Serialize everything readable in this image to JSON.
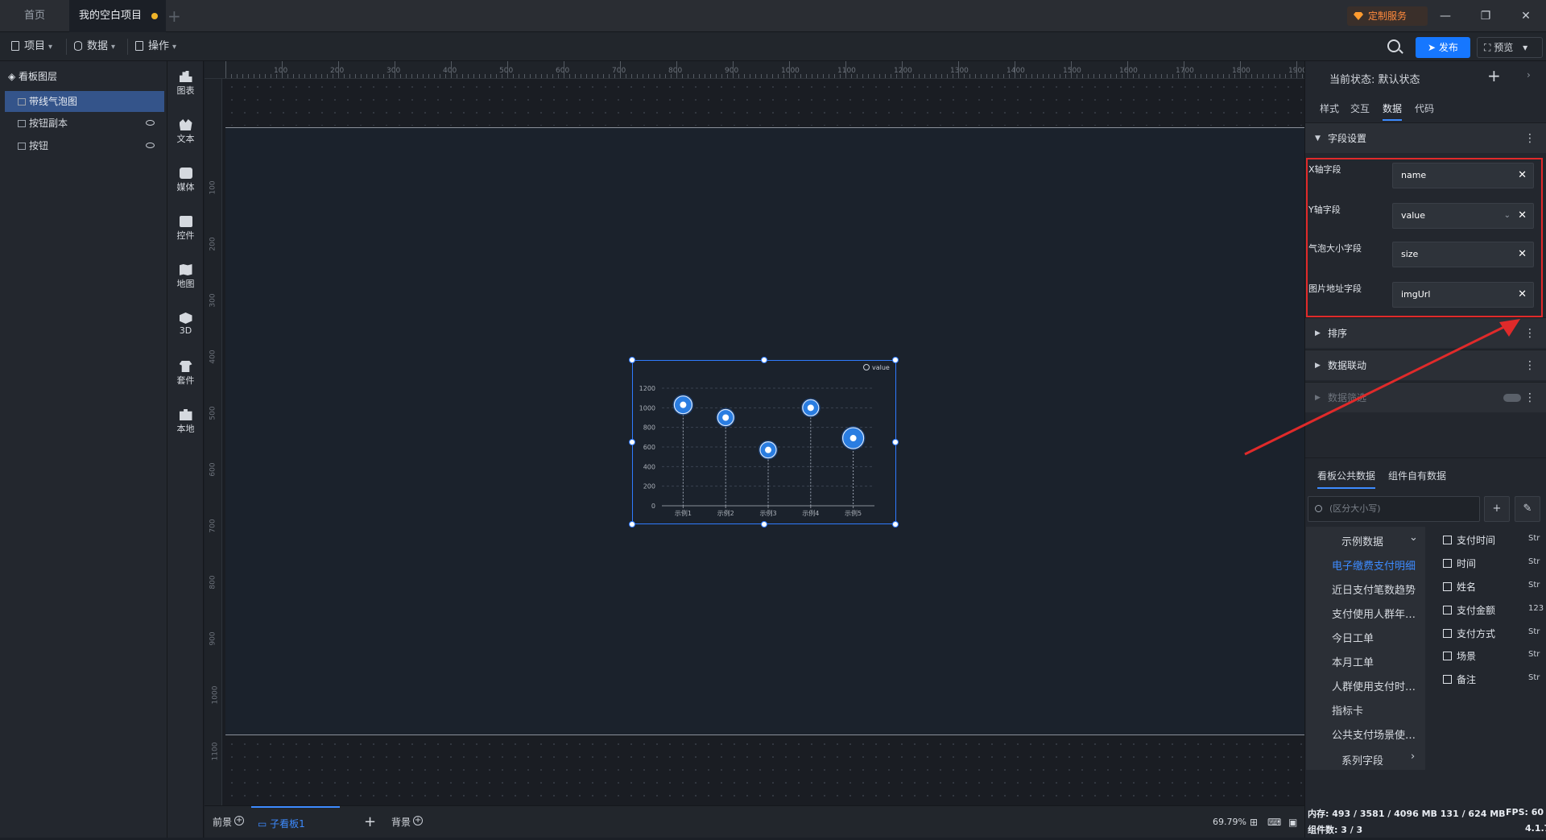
{
  "titlebar": {
    "tab_home": "首页",
    "tab_project": "我的空白项目",
    "custom_service": "定制服务",
    "add_tab": "+"
  },
  "toolbar": {
    "menu_project": "项目",
    "menu_data": "数据",
    "menu_ops": "操作",
    "publish": "发布",
    "preview": "预览"
  },
  "layers": {
    "title": "看板图层",
    "items": [
      {
        "label": "带线气泡图",
        "selected": true
      },
      {
        "label": "按钮副本",
        "selected": false
      },
      {
        "label": "按钮",
        "selected": false
      }
    ]
  },
  "rail": {
    "items": [
      {
        "label": "图表",
        "icon": "chart-icon"
      },
      {
        "label": "文本",
        "icon": "text-icon"
      },
      {
        "label": "媒体",
        "icon": "media-icon"
      },
      {
        "label": "控件",
        "icon": "control-icon"
      },
      {
        "label": "地图",
        "icon": "map-icon"
      },
      {
        "label": "3D",
        "icon": "cube-icon"
      },
      {
        "label": "套件",
        "icon": "kit-icon"
      },
      {
        "label": "本地",
        "icon": "puzzle-icon"
      }
    ]
  },
  "ruler": {
    "top_ticks": [
      "100",
      "200",
      "300",
      "400",
      "500",
      "600",
      "700",
      "800",
      "900",
      "1000",
      "1100",
      "1200",
      "1300",
      "1400",
      "1500",
      "1600",
      "1700",
      "1800",
      "1900"
    ],
    "left_ticks": [
      "100",
      "200",
      "300",
      "400",
      "500",
      "600",
      "700",
      "800",
      "900",
      "1000",
      "1100"
    ]
  },
  "chart_data": {
    "type": "scatter",
    "title": "",
    "legend": "value",
    "legend_position": "top-right",
    "categories": [
      "示例1",
      "示例2",
      "示例3",
      "示例4",
      "示例5"
    ],
    "series": [
      {
        "name": "value",
        "values": [
          1030,
          900,
          570,
          1000,
          690
        ]
      }
    ],
    "ylim": [
      0,
      1200
    ],
    "yticks": [
      0,
      200,
      400,
      600,
      800,
      1000,
      1200
    ],
    "grid": true,
    "bubble_color": "#2a7de1"
  },
  "bottombar": {
    "front": "前景",
    "subboard": "子看板1",
    "add": "+",
    "background": "背景",
    "zoom": "69.79%"
  },
  "right": {
    "state_label": "当前状态:",
    "state_value": "默认状态",
    "tabs": [
      "样式",
      "交互",
      "数据",
      "代码"
    ],
    "active_tab": "数据",
    "field_settings": "字段设置",
    "fields": [
      {
        "label": "X轴字段",
        "value": "name"
      },
      {
        "label": "Y轴字段",
        "value": "value"
      },
      {
        "label": "气泡大小字段",
        "value": "size"
      },
      {
        "label": "图片地址字段",
        "value": "imgUrl"
      }
    ],
    "sort": "排序",
    "linkage": "数据联动",
    "filter": "数据筛选",
    "data_tabs": [
      "看板公共数据",
      "组件自有数据"
    ],
    "search_placeholder": "(区分大小写)",
    "datasets_header": "示例数据",
    "datasets": [
      "电子缴费支付明细",
      "近日支付笔数趋势",
      "支付使用人群年龄...",
      "今日工单",
      "本月工单",
      "人群使用支付时间...",
      "指标卡",
      "公共支付场景使用..."
    ],
    "series_field": "系列字段",
    "columns": [
      {
        "name": "支付时间",
        "type": "Str"
      },
      {
        "name": "时间",
        "type": "Str"
      },
      {
        "name": "姓名",
        "type": "Str"
      },
      {
        "name": "支付金额",
        "type": "123"
      },
      {
        "name": "支付方式",
        "type": "Str"
      },
      {
        "name": "场景",
        "type": "Str"
      },
      {
        "name": "备注",
        "type": "Str"
      }
    ],
    "memory": "内存: 493 / 3581 / 4096 MB",
    "memory2": "131 / 624 MB",
    "fps": "FPS: 60",
    "components": "组件数: 3 / 3",
    "version": "4.1.7"
  },
  "colors": {
    "accent": "#1677ff",
    "highlight": "#e02a2a",
    "warning_dot": "#f0b429"
  }
}
